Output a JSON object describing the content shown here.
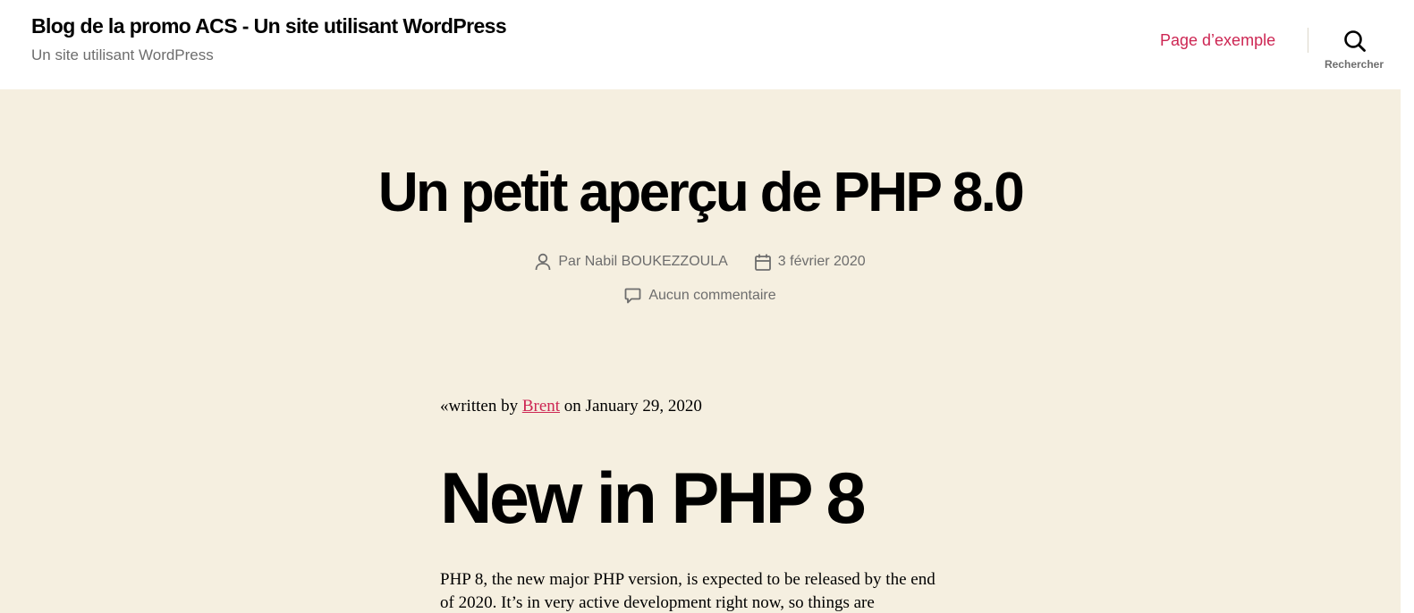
{
  "header": {
    "site_title": "Blog de la promo ACS - Un site utilisant WordPress",
    "site_description": "Un site utilisant WordPress",
    "nav": {
      "items": [
        {
          "label": "Page d’exemple"
        }
      ]
    },
    "search": {
      "label": "Rechercher",
      "icon": "search-icon"
    }
  },
  "post": {
    "title": "Un petit aperçu de PHP 8.0",
    "meta": {
      "author_prefix": "Par",
      "author": "Nabil BOUKEZZOULA",
      "author_icon": "user-icon",
      "date": "3 février 2020",
      "date_icon": "calendar-icon",
      "comments": "Aucun commentaire",
      "comments_icon": "comment-icon"
    },
    "content": {
      "written_prefix": "«written by",
      "written_author": "Brent",
      "written_suffix": "on January 29, 2020",
      "heading": "New in PHP 8",
      "paragraph": "PHP 8, the new major PHP version, is expected to be released by the end of 2020. It’s in very active development right now, so things are"
    }
  },
  "colors": {
    "accent": "#cd2653",
    "background": "#f5efe0",
    "header_background": "#ffffff",
    "secondary_text": "#6d6d6d",
    "text": "#000000"
  }
}
